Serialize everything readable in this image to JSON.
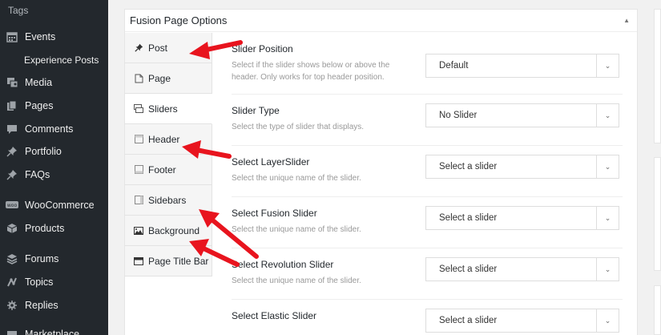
{
  "sidebar": {
    "tags_label": "Tags",
    "items": [
      {
        "label": "Events",
        "icon": "calendar-icon"
      },
      {
        "label": "Experience Posts",
        "icon": ""
      },
      {
        "label": "Media",
        "icon": "media-icon"
      },
      {
        "label": "Pages",
        "icon": "pages-icon"
      },
      {
        "label": "Comments",
        "icon": "comments-icon"
      },
      {
        "label": "Portfolio",
        "icon": "pin-icon"
      },
      {
        "label": "FAQs",
        "icon": "pin-icon"
      },
      {
        "label": "WooCommerce",
        "icon": "woo-icon"
      },
      {
        "label": "Products",
        "icon": "box-icon"
      },
      {
        "label": "Forums",
        "icon": "forums-icon"
      },
      {
        "label": "Topics",
        "icon": "topics-icon"
      },
      {
        "label": "Replies",
        "icon": "replies-icon"
      },
      {
        "label": "Marketplace",
        "icon": "market-icon"
      }
    ]
  },
  "panel": {
    "title": "Fusion Page Options",
    "tabs": [
      {
        "label": "Post",
        "icon": "pin-icon",
        "active": false
      },
      {
        "label": "Page",
        "icon": "page-icon",
        "active": false
      },
      {
        "label": "Sliders",
        "icon": "sliders-icon",
        "active": true
      },
      {
        "label": "Header",
        "icon": "header-icon",
        "active": false
      },
      {
        "label": "Footer",
        "icon": "footer-icon",
        "active": false
      },
      {
        "label": "Sidebars",
        "icon": "sidebars-icon",
        "active": false
      },
      {
        "label": "Background",
        "icon": "image-icon",
        "active": false
      },
      {
        "label": "Page Title Bar",
        "icon": "titlebar-icon",
        "active": false
      }
    ],
    "options": [
      {
        "title": "Slider Position",
        "desc": "Select if the slider shows below or above the header. Only works for top header position.",
        "value": "Default"
      },
      {
        "title": "Slider Type",
        "desc": "Select the type of slider that displays.",
        "value": "No Slider"
      },
      {
        "title": "Select LayerSlider",
        "desc": "Select the unique name of the slider.",
        "value": "Select a slider"
      },
      {
        "title": "Select Fusion Slider",
        "desc": "Select the unique name of the slider.",
        "value": "Select a slider"
      },
      {
        "title": "Select Revolution Slider",
        "desc": "Select the unique name of the slider.",
        "value": "Select a slider"
      },
      {
        "title": "Select Elastic Slider",
        "desc": "",
        "value": "Select a slider"
      }
    ]
  },
  "colors": {
    "sidebar_bg": "#23282d",
    "arrow": "#e8141e",
    "tab_bg": "#f5f5f5"
  }
}
